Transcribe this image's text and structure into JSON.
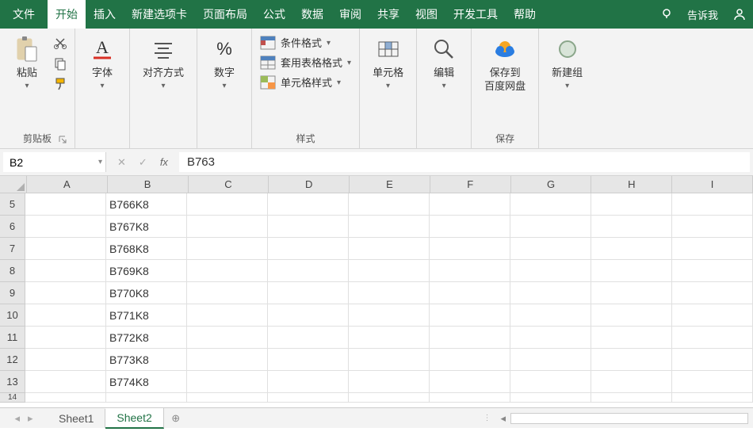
{
  "menu": {
    "file": "文件",
    "home": "开始",
    "insert": "插入",
    "newtab": "新建选项卡",
    "pagelayout": "页面布局",
    "formulas": "公式",
    "data": "数据",
    "review": "审阅",
    "share": "共享",
    "view": "视图",
    "developer": "开发工具",
    "help": "帮助",
    "tellme": "告诉我"
  },
  "ribbon": {
    "clipboard": {
      "paste": "粘贴",
      "label": "剪贴板"
    },
    "font": {
      "btn": "字体"
    },
    "align": {
      "btn": "对齐方式"
    },
    "number": {
      "btn": "数字"
    },
    "styles": {
      "conditional": "条件格式",
      "tablefmt": "套用表格格式",
      "cellstyles": "单元格样式",
      "label": "样式"
    },
    "cells": {
      "btn": "单元格"
    },
    "editing": {
      "btn": "编辑"
    },
    "save": {
      "btn": "保存到\n百度网盘",
      "label": "保存"
    },
    "newgroup": {
      "btn": "新建组"
    }
  },
  "formula_bar": {
    "name_box": "B2",
    "value": "B763"
  },
  "columns": [
    "A",
    "B",
    "C",
    "D",
    "E",
    "F",
    "G",
    "H",
    "I"
  ],
  "rows": [
    {
      "num": "5",
      "b": "B766K8"
    },
    {
      "num": "6",
      "b": "B767K8"
    },
    {
      "num": "7",
      "b": "B768K8"
    },
    {
      "num": "8",
      "b": "B769K8"
    },
    {
      "num": "9",
      "b": "B770K8"
    },
    {
      "num": "10",
      "b": "B771K8"
    },
    {
      "num": "11",
      "b": "B772K8"
    },
    {
      "num": "12",
      "b": "B773K8"
    },
    {
      "num": "13",
      "b": "B774K8"
    }
  ],
  "sheets": {
    "s1": "Sheet1",
    "s2": "Sheet2"
  }
}
